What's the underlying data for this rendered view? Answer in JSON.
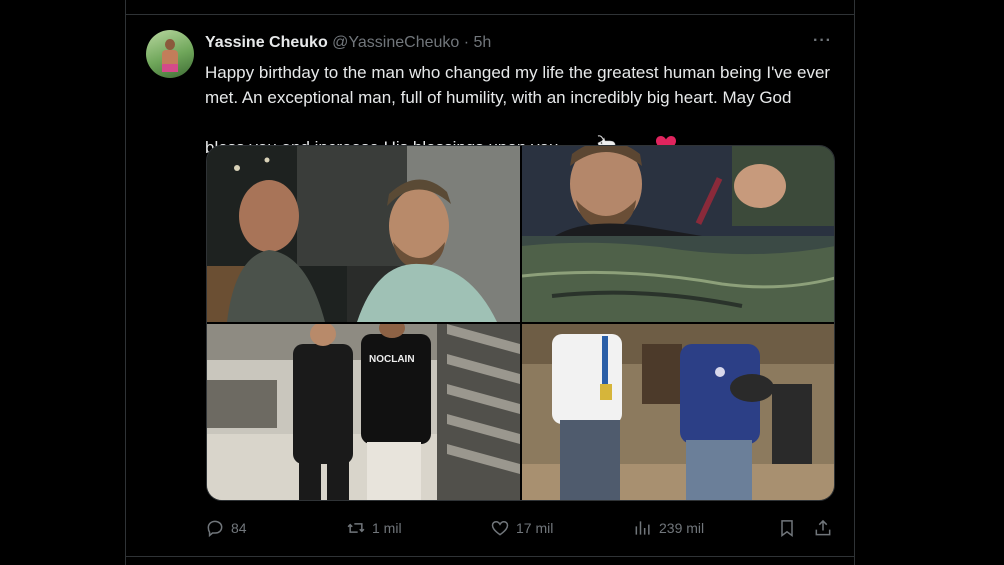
{
  "tweet": {
    "author_name": "Yassine Cheuko",
    "author_handle": "@YassineCheuko",
    "separator": "·",
    "time": "5h",
    "text": "Happy birthday to the man who changed my life the greatest human being I've ever met. An exceptional man, full of humility, with an incredibly big heart. May God bless you and increase His blessings upon you",
    "emojis": [
      "goat-emoji",
      "red-heart-emoji"
    ],
    "more_icon": "more-horizontal-icon",
    "photos": [
      {
        "name": "photo-1",
        "description_icon": "photo"
      },
      {
        "name": "photo-2",
        "description_icon": "photo"
      },
      {
        "name": "photo-3",
        "description_icon": "photo"
      },
      {
        "name": "photo-4",
        "description_icon": "photo"
      }
    ]
  },
  "actions": {
    "replies": "84",
    "reposts": "1 mil",
    "likes": "17 mil",
    "views": "239 mil"
  },
  "colors": {
    "background": "#000000",
    "text": "#e7e9ea",
    "secondary_text": "#71767b",
    "border": "#2f3336",
    "heart": "#f91880"
  }
}
